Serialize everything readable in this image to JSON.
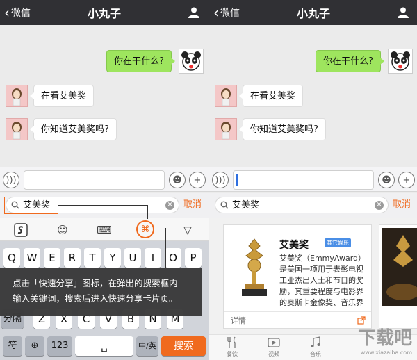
{
  "nav": {
    "back": "微信",
    "title": "小丸子"
  },
  "chat": {
    "messages": [
      {
        "side": "me",
        "text": "你在干什么?"
      },
      {
        "side": "other",
        "text": "在看艾美奖"
      },
      {
        "side": "other",
        "text": "你知道艾美奖吗?"
      }
    ]
  },
  "search": {
    "query": "艾美奖",
    "cancel": "取消"
  },
  "keyboard": {
    "row1": [
      "Q",
      "W",
      "E",
      "R",
      "T",
      "Y",
      "U",
      "I",
      "O",
      "P"
    ],
    "row3": [
      "Z",
      "X",
      "C",
      "V",
      "B",
      "N",
      "M"
    ],
    "shift": "分隔",
    "sym": "符",
    "num": "123",
    "lang": "中/英",
    "search_key": "搜索"
  },
  "tip": {
    "line1": "点击「快速分享」图标，在弹出的搜索框内",
    "line2": "输入关键词，搜索后进入快速分享卡片页。"
  },
  "card": {
    "title": "艾美奖",
    "badge": "其它娱乐",
    "description": "艾美奖（EmmyAward）是美国一项用于表彰电视工业杰出人士和节目的奖励，其重要程度与电影界的奥斯卡金像奖、音乐界的格莱美奖以及戏剧界的",
    "detail": "详情"
  },
  "tabs": [
    {
      "label": "餐饮",
      "icon": "fork-knife-icon"
    },
    {
      "label": "视频",
      "icon": "video-icon"
    },
    {
      "label": "音乐",
      "icon": "music-icon"
    }
  ],
  "watermark": {
    "main": "下载吧",
    "sub": "www.xiazaiba.com"
  }
}
